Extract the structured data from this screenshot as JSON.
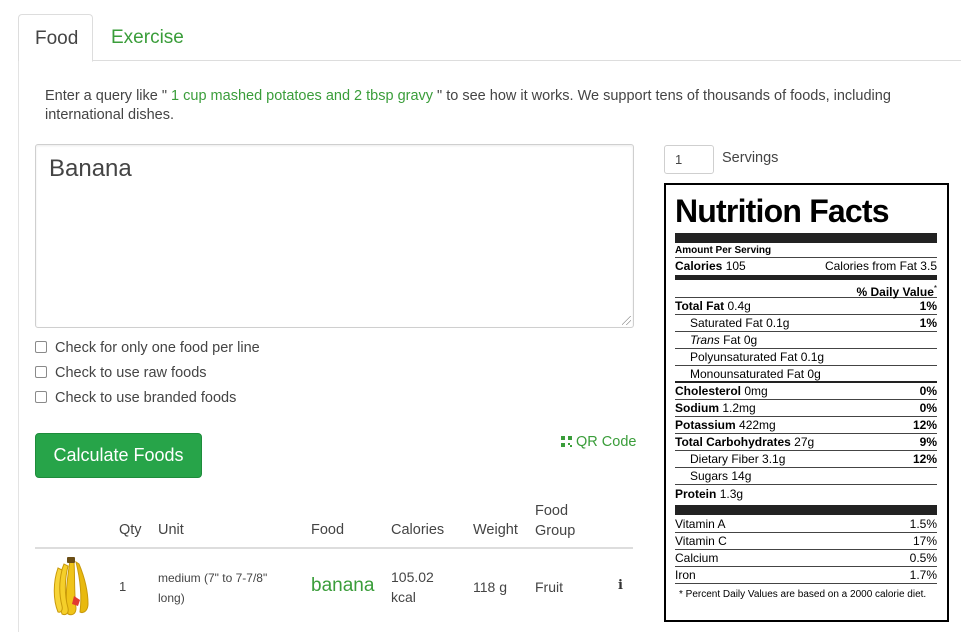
{
  "tabs": {
    "food": "Food",
    "exercise": "Exercise"
  },
  "intro": {
    "before": "Enter a query like \" ",
    "example": "1 cup mashed potatoes and 2 tbsp gravy",
    "after": " \" to see how it works. We support tens of thousands of foods, including international dishes."
  },
  "query": {
    "value": "Banana"
  },
  "options": [
    {
      "label": "Check for only one food per line",
      "checked": false
    },
    {
      "label": "Check to use raw foods",
      "checked": false
    },
    {
      "label": "Check to use branded foods",
      "checked": false
    }
  ],
  "calculate_button": "Calculate Foods",
  "qr_code_link": "QR Code",
  "table": {
    "headers": {
      "qty": "Qty",
      "unit": "Unit",
      "food": "Food",
      "calories": "Calories",
      "weight": "Weight",
      "food_group_1": "Food",
      "food_group_2": "Group"
    },
    "rows": [
      {
        "qty": "1",
        "unit_1": "medium (7\" to 7-7/8\"",
        "unit_2": "long)",
        "food": "banana",
        "calories_1": "105.02",
        "calories_2": "kcal",
        "weight": "118 g",
        "food_group": "Fruit",
        "info_icon": "info-icon"
      }
    ]
  },
  "servings": {
    "value": "1",
    "label": "Servings"
  },
  "nutrition": {
    "title": "Nutrition Facts",
    "amount_per_serving": "Amount Per Serving",
    "calories_label": "Calories",
    "calories_value": "105",
    "calories_from_fat": "Calories from Fat 3.5",
    "daily_value_header": "% Daily Value",
    "daily_value_star": "*",
    "nutrients": [
      {
        "name": "Total Fat",
        "amount": "0.4g",
        "dv": "1%",
        "bold": true,
        "indent": false
      },
      {
        "name": "Saturated Fat",
        "amount": "0.1g",
        "dv": "1%",
        "bold": false,
        "indent": true
      },
      {
        "name": "Trans",
        "name_suffix": "Fat",
        "amount": "0g",
        "dv": "",
        "bold": false,
        "indent": true,
        "italic": true
      },
      {
        "name": "Polyunsaturated Fat",
        "amount": "0.1g",
        "dv": "",
        "bold": false,
        "indent": true
      },
      {
        "name": "Monounsaturated Fat",
        "amount": "0g",
        "dv": "",
        "bold": false,
        "indent": true
      },
      {
        "name": "Cholesterol",
        "amount": "0mg",
        "dv": "0%",
        "bold": true,
        "indent": false
      },
      {
        "name": "Sodium",
        "amount": "1.2mg",
        "dv": "0%",
        "bold": true,
        "indent": false
      },
      {
        "name": "Potassium",
        "amount": "422mg",
        "dv": "12%",
        "bold": true,
        "indent": false
      },
      {
        "name": "Total Carbohydrates",
        "amount": "27g",
        "dv": "9%",
        "bold": true,
        "indent": false
      },
      {
        "name": "Dietary Fiber",
        "amount": "3.1g",
        "dv": "12%",
        "bold": false,
        "indent": true
      },
      {
        "name": "Sugars",
        "amount": "14g",
        "dv": "",
        "bold": false,
        "indent": true
      },
      {
        "name": "Protein",
        "amount": "1.3g",
        "dv": "",
        "bold": true,
        "indent": false
      }
    ],
    "vitamins": [
      {
        "name": "Vitamin A",
        "dv": "1.5%"
      },
      {
        "name": "Vitamin C",
        "dv": "17%"
      },
      {
        "name": "Calcium",
        "dv": "0.5%"
      },
      {
        "name": "Iron",
        "dv": "1.7%"
      }
    ],
    "footnote": "* Percent Daily Values are based on a 2000 calorie diet."
  },
  "colors": {
    "accent_green": "#3a9d3a",
    "button_green": "#27a449"
  }
}
